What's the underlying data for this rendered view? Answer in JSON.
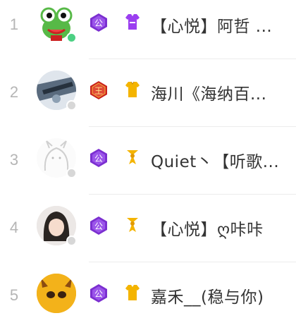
{
  "colors": {
    "online": "#4cd083",
    "offline": "#d7d7d7",
    "badge_public": "#7b2fd0",
    "badge_king": "#c9221e",
    "medal_purple": "#9b3ff0",
    "medal_gold": "#f4b400"
  },
  "rows": [
    {
      "rank": "1",
      "name": "【心悦】阿哲 ...",
      "badge_text": "公",
      "badge_type": "public",
      "medal": "shirt-purple-icon",
      "status": "online"
    },
    {
      "rank": "2",
      "name": "海川《海纳百...",
      "badge_text": "王",
      "badge_type": "king",
      "medal": "shirt-gold-icon",
      "status": "offline"
    },
    {
      "rank": "3",
      "name": "Quiet丶【听歌...",
      "badge_text": "公",
      "badge_type": "public",
      "medal": "bowtie-gold-icon",
      "status": "offline"
    },
    {
      "rank": "4",
      "name": "【心悦】ღ咔咔",
      "badge_text": "公",
      "badge_type": "public",
      "medal": "bowtie-gold-icon",
      "status": "offline"
    },
    {
      "rank": "5",
      "name": "嘉禾__(稳与你)",
      "badge_text": "公",
      "badge_type": "public",
      "medal": "shirt-gold-icon",
      "status": "offline"
    }
  ]
}
